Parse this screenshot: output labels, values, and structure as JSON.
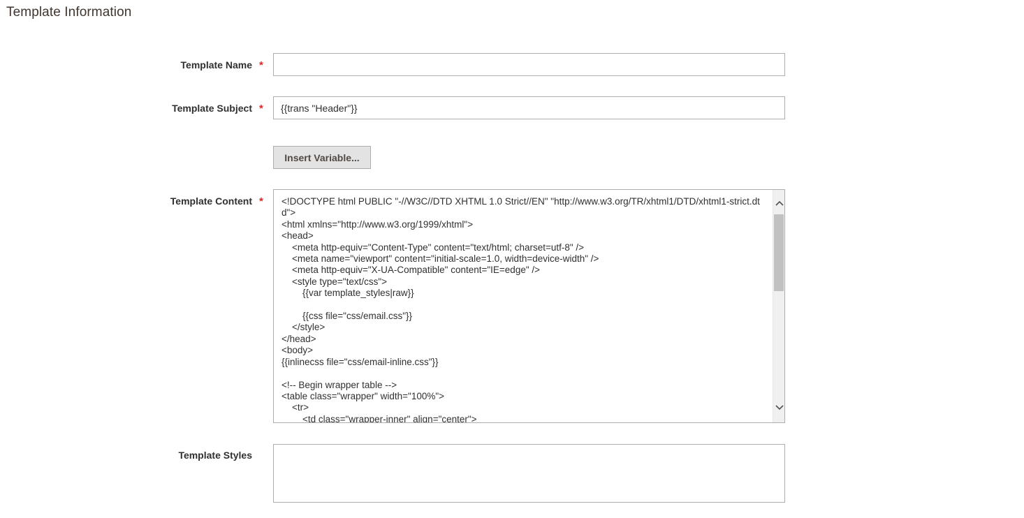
{
  "section": {
    "title": "Template Information"
  },
  "fields": {
    "name": {
      "label": "Template Name",
      "required_mark": "*",
      "value": ""
    },
    "subject": {
      "label": "Template Subject",
      "required_mark": "*",
      "value": "{{trans \"Header\"}}"
    },
    "insert_variable": {
      "label": "Insert Variable..."
    },
    "content": {
      "label": "Template Content",
      "required_mark": "*",
      "value": "<!DOCTYPE html PUBLIC \"-//W3C//DTD XHTML 1.0 Strict//EN\" \"http://www.w3.org/TR/xhtml1/DTD/xhtml1-strict.dtd\">\n<html xmlns=\"http://www.w3.org/1999/xhtml\">\n<head>\n    <meta http-equiv=\"Content-Type\" content=\"text/html; charset=utf-8\" />\n    <meta name=\"viewport\" content=\"initial-scale=1.0, width=device-width\" />\n    <meta http-equiv=\"X-UA-Compatible\" content=\"IE=edge\" />\n    <style type=\"text/css\">\n        {{var template_styles|raw}}\n\n        {{css file=\"css/email.css\"}}\n    </style>\n</head>\n<body>\n{{inlinecss file=\"css/email-inline.css\"}}\n\n<!-- Begin wrapper table -->\n<table class=\"wrapper\" width=\"100%\">\n    <tr>\n        <td class=\"wrapper-inner\" align=\"center\">"
    },
    "styles": {
      "label": "Template Styles",
      "value": ""
    }
  },
  "colors": {
    "required": "#e22626",
    "border": "#adadad",
    "button_bg": "#e3e3e3"
  },
  "icons": {
    "scroll_up": "chevron-up-icon",
    "scroll_down": "chevron-down-icon"
  }
}
